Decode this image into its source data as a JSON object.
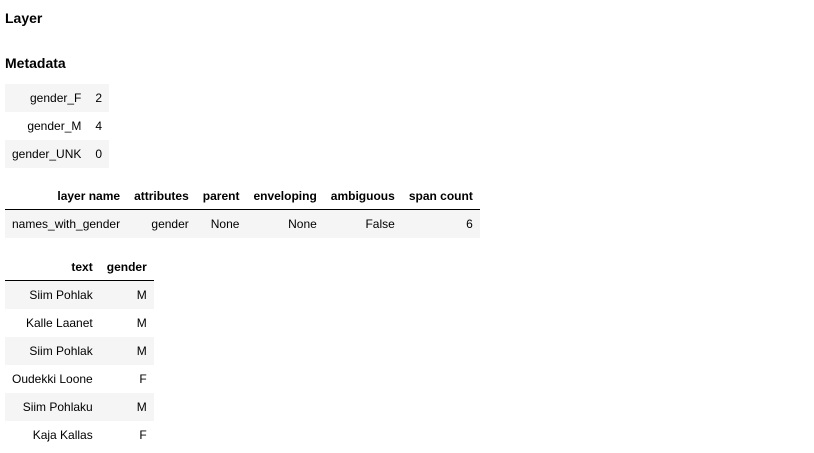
{
  "headings": {
    "layer": "Layer",
    "metadata": "Metadata"
  },
  "metadata": [
    {
      "key": "gender_F",
      "value": "2"
    },
    {
      "key": "gender_M",
      "value": "4"
    },
    {
      "key": "gender_UNK",
      "value": "0"
    }
  ],
  "layer_table": {
    "columns": [
      "layer name",
      "attributes",
      "parent",
      "enveloping",
      "ambiguous",
      "span count"
    ],
    "row": [
      "names_with_gender",
      "gender",
      "None",
      "None",
      "False",
      "6"
    ]
  },
  "span_table": {
    "columns": [
      "text",
      "gender"
    ],
    "rows": [
      [
        "Siim Pohlak",
        "M"
      ],
      [
        "Kalle Laanet",
        "M"
      ],
      [
        "Siim Pohlak",
        "M"
      ],
      [
        "Oudekki Loone",
        "F"
      ],
      [
        "Siim Pohlaku",
        "M"
      ],
      [
        "Kaja Kallas",
        "F"
      ]
    ]
  }
}
